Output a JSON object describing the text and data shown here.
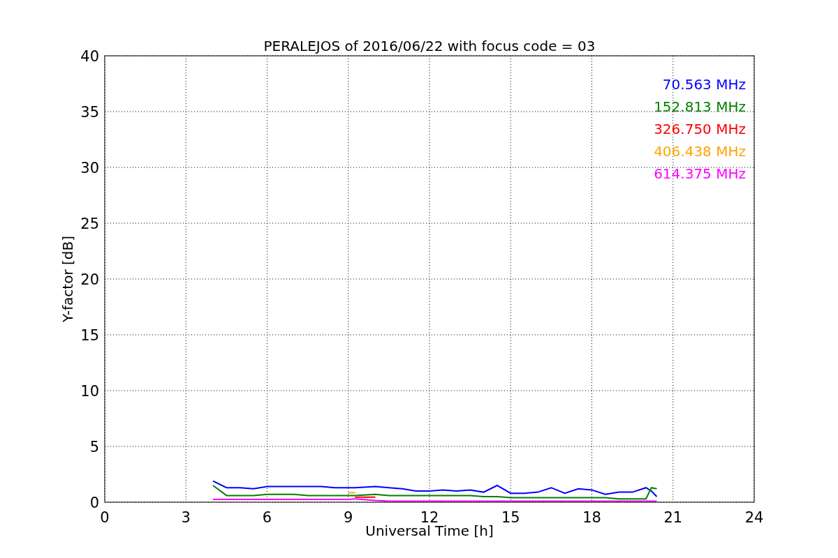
{
  "figure": {
    "chart_data": {
      "type": "line",
      "title": "PERALEJOS of 2016/06/22 with focus code = 03",
      "xlabel": "Universal Time [h]",
      "ylabel": "Y-factor [dB]",
      "x": [
        4,
        4.5,
        5,
        5.5,
        6,
        6.5,
        7,
        7.5,
        8,
        8.5,
        9,
        9.25,
        10,
        10.5,
        11,
        11.5,
        12,
        12.5,
        13,
        13.5,
        14,
        14.5,
        15,
        15.5,
        16,
        16.5,
        17,
        17.5,
        18,
        18.5,
        19,
        19.5,
        20,
        20.2,
        20.4
      ],
      "series": [
        {
          "name": "70.563 MHz",
          "color": "#0000ff",
          "values": [
            1.9,
            1.3,
            1.3,
            1.2,
            1.4,
            1.4,
            1.4,
            1.4,
            1.4,
            1.3,
            1.3,
            1.3,
            1.4,
            1.3,
            1.2,
            1.0,
            1.0,
            1.1,
            1.0,
            1.1,
            0.9,
            1.5,
            0.8,
            0.8,
            0.9,
            1.3,
            0.8,
            1.2,
            1.1,
            0.7,
            0.9,
            0.9,
            1.3,
            1.0,
            0.5
          ]
        },
        {
          "name": "152.813 MHz",
          "color": "#008000",
          "values": [
            1.5,
            0.6,
            0.6,
            0.6,
            0.7,
            0.7,
            0.7,
            0.6,
            0.6,
            0.6,
            0.6,
            0.6,
            0.7,
            0.6,
            0.6,
            0.6,
            0.6,
            0.6,
            0.6,
            0.6,
            0.5,
            0.5,
            0.4,
            0.4,
            0.4,
            0.4,
            0.4,
            0.4,
            0.4,
            0.4,
            0.3,
            0.3,
            0.3,
            1.3,
            1.2
          ]
        },
        {
          "name": "326.750 MHz",
          "color": "#ff0000",
          "values": [
            null,
            null,
            null,
            null,
            null,
            null,
            null,
            null,
            null,
            null,
            null,
            0.45,
            0.45,
            null,
            null,
            null,
            null,
            null,
            null,
            null,
            null,
            null,
            null,
            null,
            null,
            null,
            null,
            null,
            null,
            null,
            null,
            null,
            null,
            null,
            null
          ]
        },
        {
          "name": "406.438 MHz",
          "color": "#ffa500",
          "values": [
            null,
            null,
            null,
            null,
            null,
            null,
            null,
            null,
            null,
            null,
            0.85,
            0.85,
            null,
            null,
            null,
            null,
            null,
            null,
            null,
            null,
            null,
            null,
            null,
            null,
            null,
            null,
            null,
            null,
            null,
            null,
            null,
            null,
            null,
            null,
            null
          ]
        },
        {
          "name": "614.375 MHz",
          "color": "#ff00ff",
          "values": [
            0.25,
            0.25,
            0.25,
            0.25,
            0.25,
            0.25,
            0.25,
            0.25,
            0.25,
            0.25,
            0.25,
            0.3,
            0.15,
            0.1,
            0.1,
            0.1,
            0.1,
            0.1,
            0.1,
            0.1,
            0.1,
            0.1,
            0.1,
            0.1,
            0.1,
            0.1,
            0.1,
            0.1,
            0.1,
            0.1,
            0.1,
            0.1,
            0.1,
            0.1,
            0.1
          ]
        }
      ],
      "grid": true,
      "xlim": [
        0,
        24
      ],
      "ylim": [
        0,
        40
      ],
      "xticks": [
        0,
        3,
        6,
        9,
        12,
        15,
        18,
        21,
        24
      ],
      "yticks": [
        0,
        5,
        10,
        15,
        20,
        25,
        30,
        35,
        40
      ]
    }
  }
}
